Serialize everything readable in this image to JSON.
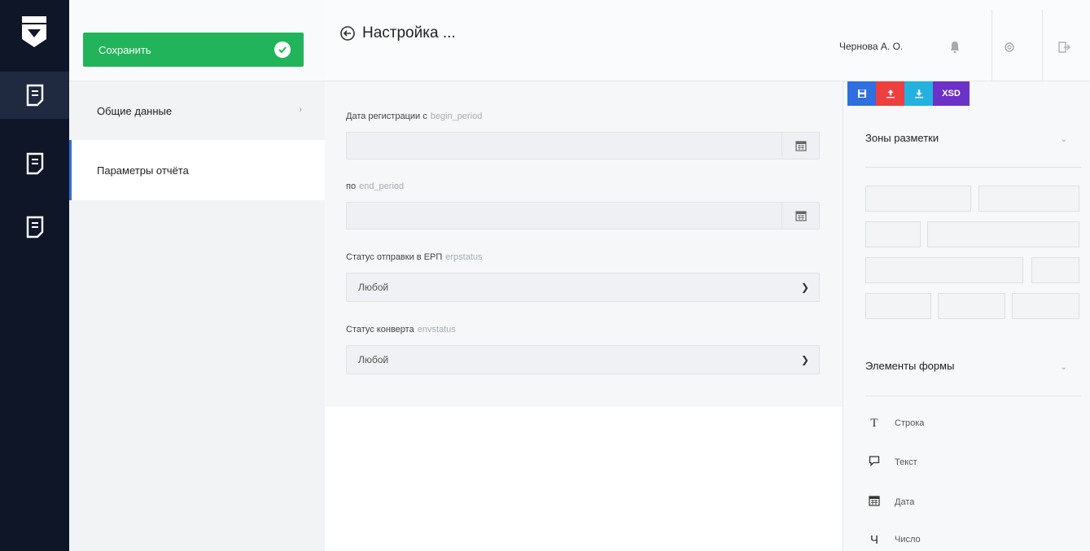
{
  "toolbar": {
    "save_label": "Сохранить"
  },
  "header": {
    "title": "Настройка ...",
    "user": "Чернова А. О."
  },
  "nav": {
    "items": [
      {
        "label": "Общие данные"
      },
      {
        "label": "Параметры отчёта"
      }
    ]
  },
  "form": {
    "fields": [
      {
        "label": "Дата регистрации с",
        "code": "begin_period"
      },
      {
        "label": "по",
        "code": "end_period"
      },
      {
        "label": "Статус отправки в ЕРП",
        "code": "erpstatus",
        "value": "Любой"
      },
      {
        "label": "Статус конверта",
        "code": "envstatus",
        "value": "Любой"
      }
    ]
  },
  "right_panel": {
    "toolbar": {
      "xsd_label": "XSD"
    },
    "zones_title": "Зоны разметки",
    "elements_title": "Элементы формы",
    "elements": [
      {
        "label": "Строка",
        "icon": "text-t-icon"
      },
      {
        "label": "Текст",
        "icon": "comment-icon"
      },
      {
        "label": "Дата",
        "icon": "calendar-icon"
      },
      {
        "label": "Число",
        "icon": "number-icon"
      }
    ]
  },
  "colors": {
    "rail_bg": "#0e1628",
    "save_green": "#22b45a",
    "accent_blue": "#2f6fe0",
    "tb_red": "#ee3f3f",
    "tb_cyan": "#23b2e0",
    "tb_purple": "#6c32c7"
  }
}
